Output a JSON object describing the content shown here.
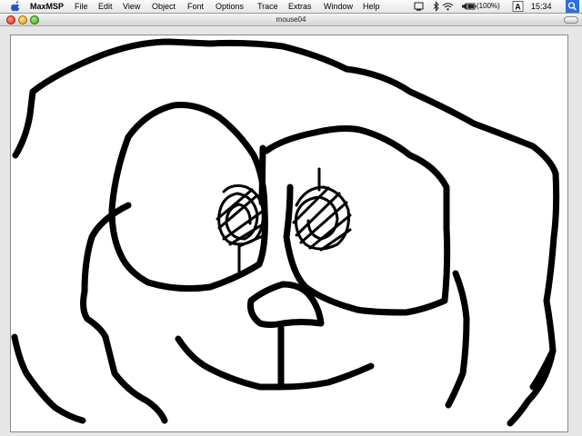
{
  "menubar": {
    "app_name": "MaxMSP",
    "menus": [
      "File",
      "Edit",
      "View",
      "Object",
      "Font",
      "Options",
      "Trace",
      "Extras",
      "Window",
      "Help"
    ],
    "battery": "(100%)",
    "clock": "15:34",
    "icons": [
      "apple-logo-icon",
      "display-icon",
      "bluetooth-icon",
      "wifi-icon",
      "volume-icon",
      "battery-icon",
      "input-menu-icon",
      "spotlight-icon"
    ]
  },
  "window": {
    "title": "mouse04"
  },
  "colors": {
    "stroke": "#000000",
    "canvas": "#ffffff",
    "spotlight": "#2f6fd6"
  }
}
